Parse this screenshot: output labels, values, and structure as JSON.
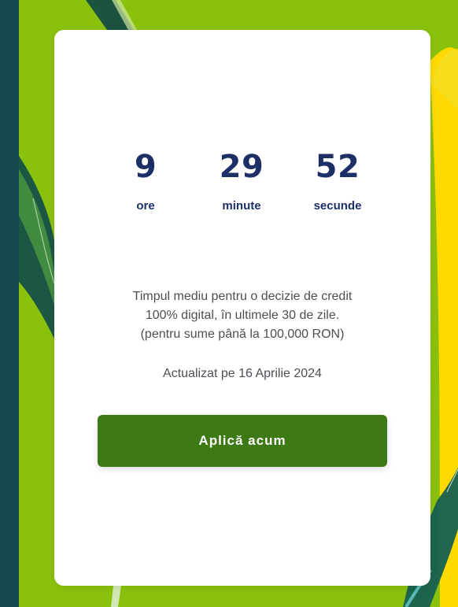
{
  "countdown": {
    "hours": {
      "value": "9",
      "label": "ore"
    },
    "minutes": {
      "value": "29",
      "label": "minute"
    },
    "seconds": {
      "value": "52",
      "label": "secunde"
    }
  },
  "description": {
    "lines": [
      "Timpul mediu pentru o decizie de credit",
      "100% digital, în ultimele 30 de zile.",
      "(pentru sume până la 100,000 RON)"
    ]
  },
  "updated_text": "Actualizat pe 16 Aprilie 2024",
  "cta": {
    "label": "Aplică acum"
  },
  "colors": {
    "background_green": "#8ac10c",
    "dark_teal": "#174850",
    "card_background": "#ffffff",
    "countdown_blue": "#1c2f67",
    "button_green": "#3d7a15",
    "accent_yellow": "#ffd900"
  },
  "icons": [
    "leaf-decoration-icon",
    "stripe-decoration-icon"
  ]
}
